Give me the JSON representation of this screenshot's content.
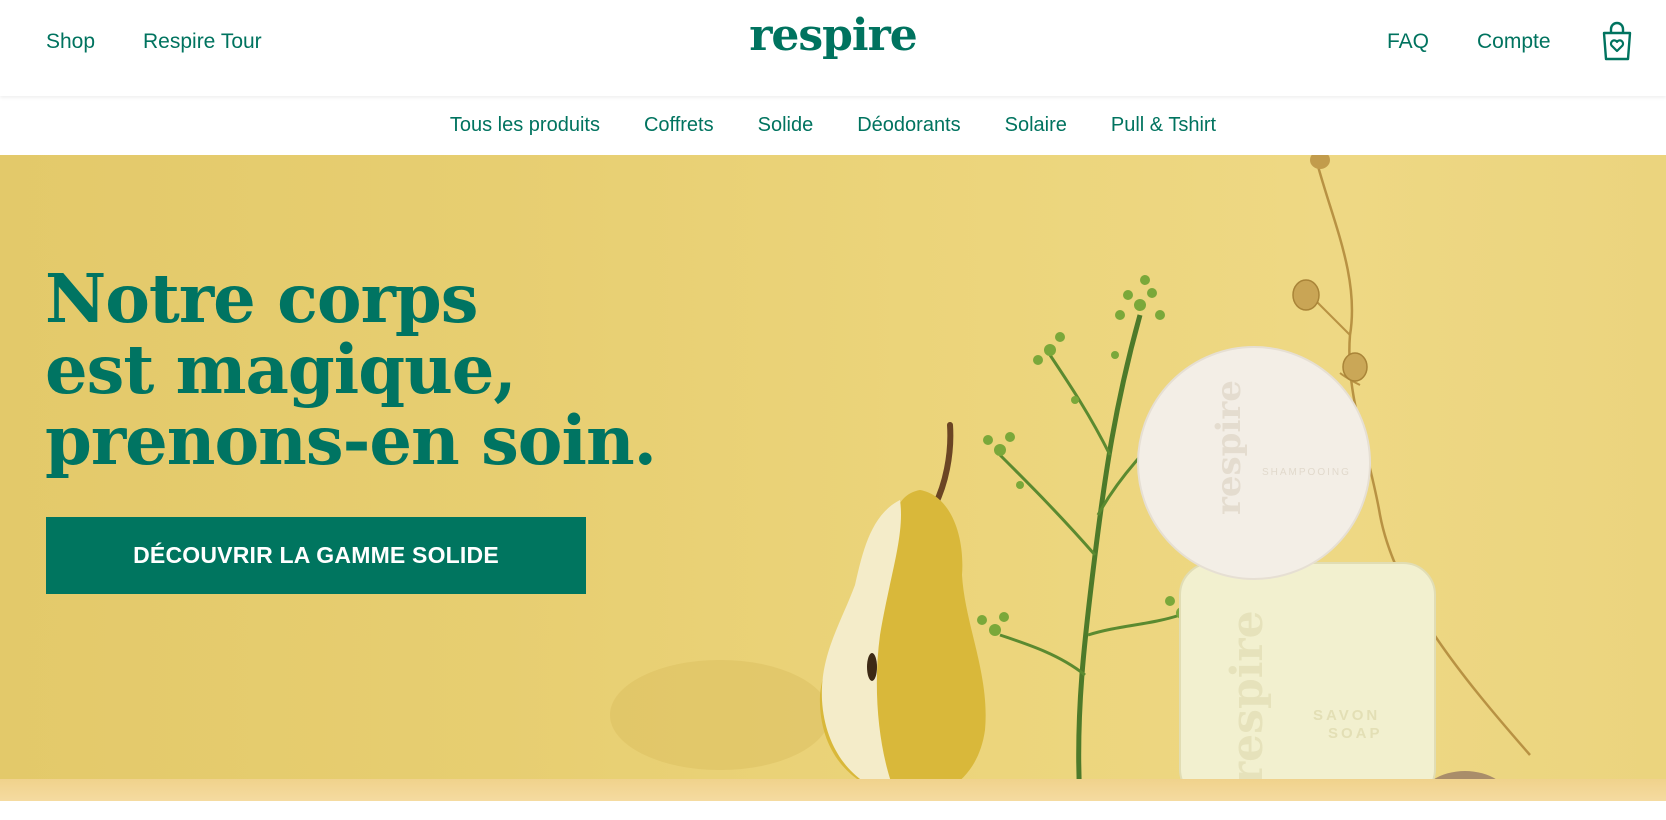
{
  "header": {
    "left_links": [
      "Shop",
      "Respire Tour"
    ],
    "logo": "respire",
    "right_links": [
      "FAQ",
      "Compte"
    ],
    "cart_icon": "shopping-bag-heart-icon"
  },
  "category_nav": {
    "items": [
      "Tous les produits",
      "Coffrets",
      "Solide",
      "Déodorants",
      "Solaire",
      "Pull & Tshirt"
    ]
  },
  "hero": {
    "headline": [
      "Notre corps",
      "est magique,",
      "prenons-en soin."
    ],
    "cta_label": "DÉCOUVRIR LA GAMME SOLIDE",
    "image_description_icons": [
      "pear-icon",
      "flowering-branch-icon",
      "round-soap-icon",
      "square-soap-icon",
      "dried-stem-icon"
    ]
  },
  "colors": {
    "brand_green": "#00735f",
    "hero_yellow": "#e8cf74",
    "cta_text": "#ffffff"
  }
}
